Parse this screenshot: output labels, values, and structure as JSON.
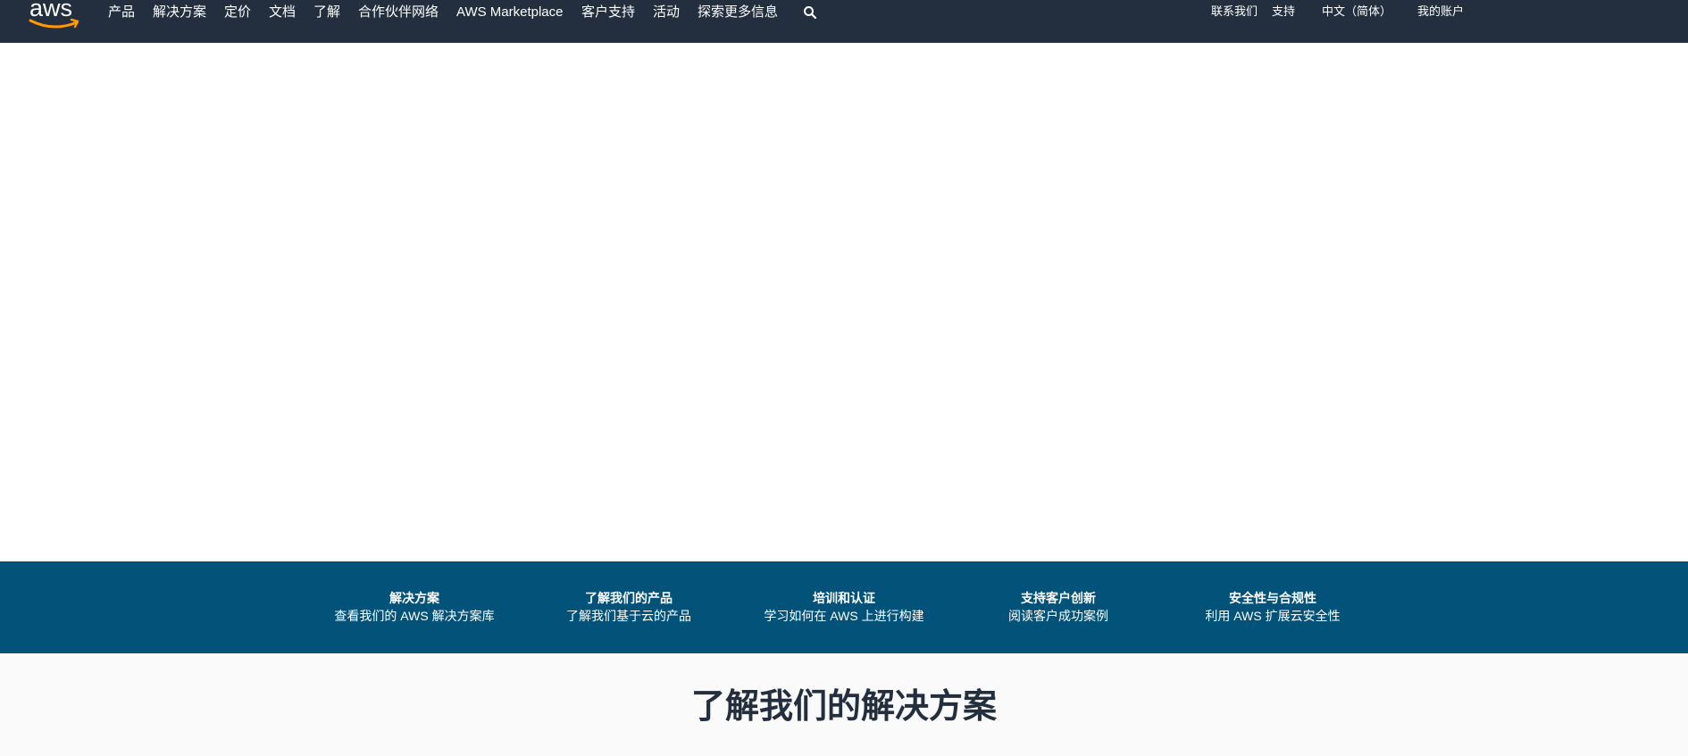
{
  "brand": {
    "logo_text": "aws",
    "smile_color": "#ff9900"
  },
  "nav": {
    "items": [
      {
        "label": "产品"
      },
      {
        "label": "解决方案"
      },
      {
        "label": "定价"
      },
      {
        "label": "文档"
      },
      {
        "label": "了解"
      },
      {
        "label": "合作伙伴网络"
      },
      {
        "label": "AWS Marketplace"
      },
      {
        "label": "客户支持"
      },
      {
        "label": "活动"
      },
      {
        "label": "探索更多信息"
      }
    ],
    "search_icon": "search-icon"
  },
  "utility": {
    "contact": "联系我们",
    "support": "支持",
    "language": "中文（简体）",
    "account": "我的账户"
  },
  "band": {
    "items": [
      {
        "title": "解决方案",
        "subtitle": "查看我们的 AWS 解决方案库"
      },
      {
        "title": "了解我们的产品",
        "subtitle": "了解我们基于云的产品"
      },
      {
        "title": "培训和认证",
        "subtitle": "学习如何在 AWS 上进行构建"
      },
      {
        "title": "支持客户创新",
        "subtitle": "阅读客户成功案例"
      },
      {
        "title": "安全性与合规性",
        "subtitle": "利用 AWS 扩展云安全性"
      }
    ]
  },
  "solutions": {
    "heading": "了解我们的解决方案"
  },
  "colors": {
    "nav_background": "#232f3e",
    "band_background": "#03527a",
    "section_background": "#fafafa",
    "heading_color": "#232f3e"
  }
}
